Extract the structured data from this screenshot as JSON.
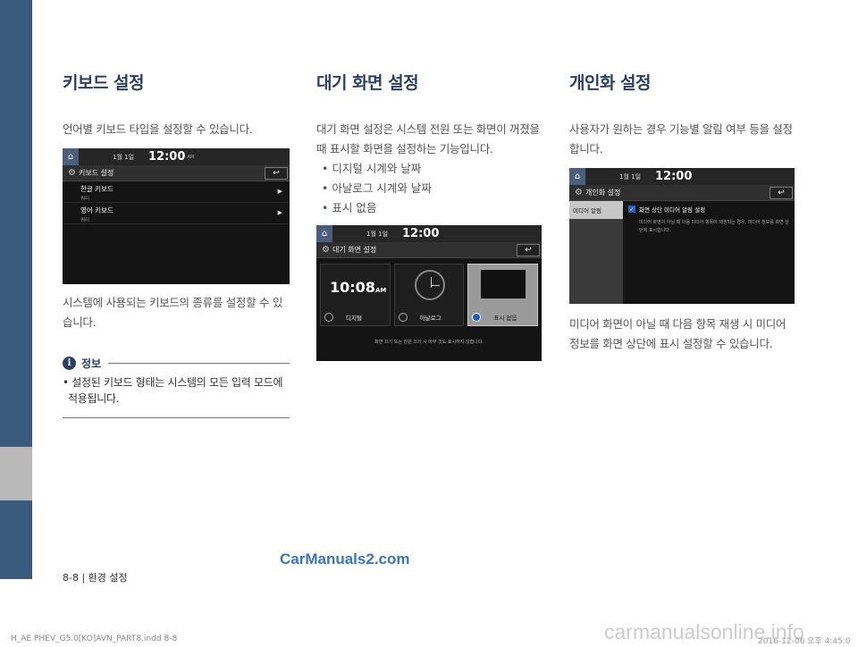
{
  "sections": {
    "keyboard": {
      "title": "키보드 설정",
      "intro": "언어별 키보드 타입을 설정할 수 있습니다.",
      "after": "시스템에 사용되는 키보드의 종류를 설정할 수 있습니다.",
      "screen": {
        "date": "1월 1일",
        "time": "12:00",
        "ampm": "AM",
        "title": "키보드 설정",
        "rows": [
          {
            "label": "한글 키보드",
            "sub": "쿼티"
          },
          {
            "label": "영어 키보드",
            "sub": "쿼티"
          }
        ]
      },
      "info": {
        "icon": "i",
        "title": "정보",
        "body": "• 설정된 키보드 형태는 시스템의 모든 입력 모드에 적용됩니다."
      }
    },
    "standby": {
      "title": "대기 화면 설정",
      "intro": "대기 화면 설정은 시스템 전원 또는 화면이 꺼졌을 때 표시할 화면을 설정하는 기능입니다.",
      "bullets": [
        "디지털 시계와 날짜",
        "아날로그 시계와 날짜",
        "표시 없음"
      ],
      "screen": {
        "date": "1월 1일",
        "time": "12:00",
        "title": "대기 화면 설정",
        "digital_time": "10:08",
        "digital_ampm": "AM",
        "options": [
          "디지털",
          "아날로그",
          "표시 없음"
        ],
        "footer": "화면 끄기 또는 전원 끄기 시 아무 것도 표시하지 않습니다."
      }
    },
    "personal": {
      "title": "개인화 설정",
      "intro": "사용자가 원하는 경우 기능별 알림 여부 등을 설정합니다.",
      "after": "미디어 화면이 아닐 때 다음 항목 재생 시 미디어 정보를 화면 상단에 표시 설정할 수 있습니다.",
      "screen": {
        "date": "1월 1일",
        "time": "12:00",
        "title": "개인화 설정",
        "menu": "미디어 알림",
        "check_label": "화면 상단 미디어 알림 설정",
        "desc": "미디어 화면이 아닐 때 다음 미디어 항목이 재생되는 경우, 미디어 정보를 화면 상단에 표시합니다."
      }
    }
  },
  "footer": {
    "page": "8-8 | 환경 설정",
    "watermark": "CarManuals2.com",
    "print_left": "H_AE PHEV_G5.0[KO]AVN_PART8.indd   8-8",
    "print_right": "2016-12-06   오후 4:45:0",
    "watermark2": "carmanualsonline.info"
  }
}
